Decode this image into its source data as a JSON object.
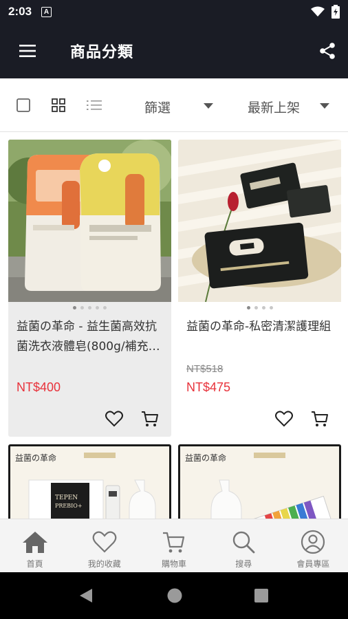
{
  "status_bar": {
    "time": "2:03",
    "notification_letter": "A"
  },
  "app_bar": {
    "title": "商品分類",
    "menu_icon": "hamburger-icon",
    "share_icon": "share-icon"
  },
  "toolbar": {
    "filter_label": "篩選",
    "sort_label": "最新上架"
  },
  "products": [
    {
      "name": "益菌の革命 - 益生菌高效抗菌洗衣液體皂(800g/補充…",
      "old_price": "",
      "price": "NT$400",
      "image_dots": 5,
      "active_dot": 1
    },
    {
      "name": "益菌の革命-私密清潔護理組",
      "old_price": "NT$518",
      "price": "NT$475",
      "image_dots": 4,
      "active_dot": 1
    },
    {
      "name": "",
      "old_price": "",
      "price": ""
    },
    {
      "name": "",
      "old_price": "",
      "price": ""
    }
  ],
  "product_images": {
    "p3_brand": "益菌の革命",
    "p3_box_text_line1": "TEPEN",
    "p3_box_text_line2": "PREBIO+",
    "p4_brand": "益菌の革命"
  },
  "bottom_nav": [
    {
      "label": "首頁",
      "icon": "home-icon"
    },
    {
      "label": "我的收藏",
      "icon": "heart-icon"
    },
    {
      "label": "購物車",
      "icon": "cart-icon"
    },
    {
      "label": "搜尋",
      "icon": "search-icon"
    },
    {
      "label": "會員專區",
      "icon": "user-icon"
    }
  ],
  "colors": {
    "app_bar": "#1a1c25",
    "price_red": "#e8323b",
    "card_gray": "#ececec"
  }
}
